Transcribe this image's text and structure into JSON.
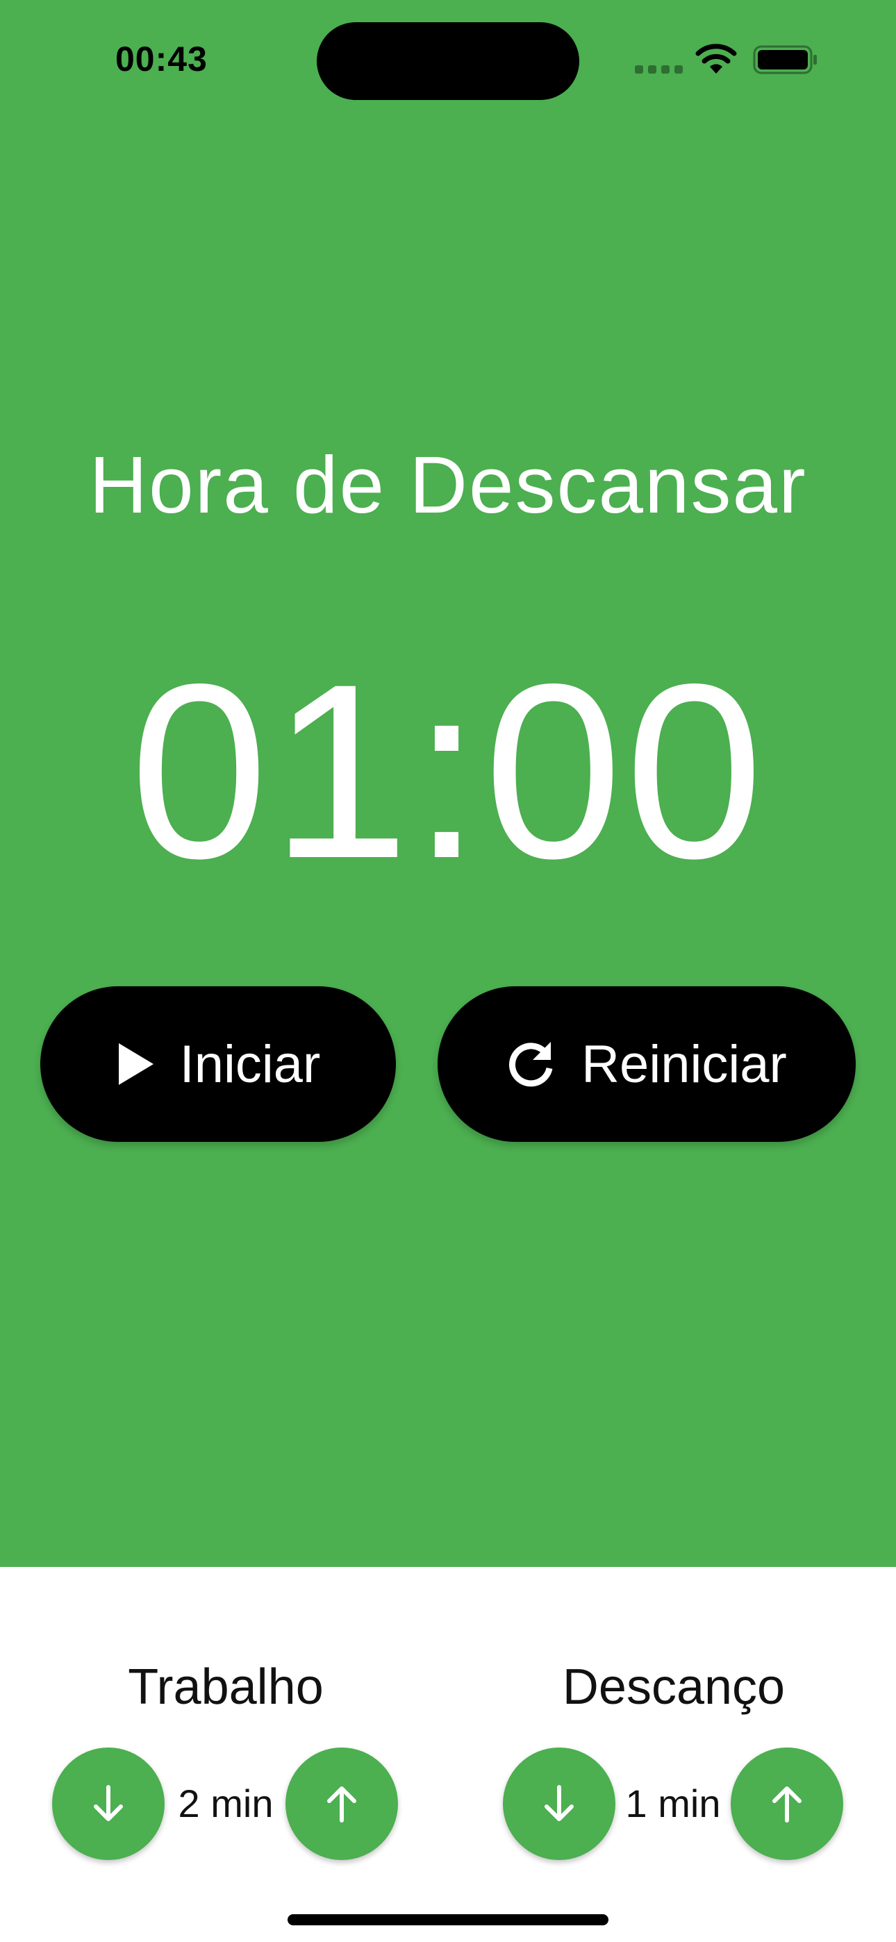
{
  "status_bar": {
    "time": "00:43"
  },
  "screen": {
    "background_color": "#4caf50",
    "title": "Hora de Descansar",
    "timer": "01:00"
  },
  "actions": {
    "start": {
      "label": "Iniciar",
      "icon": "play-icon"
    },
    "reset": {
      "label": "Reiniciar",
      "icon": "refresh-icon"
    }
  },
  "settings": {
    "work": {
      "label": "Trabalho",
      "value": "2 min",
      "decrease_icon": "arrow-down-icon",
      "increase_icon": "arrow-up-icon"
    },
    "rest": {
      "label": "Descanço",
      "value": "1 min",
      "decrease_icon": "arrow-down-icon",
      "increase_icon": "arrow-up-icon"
    }
  }
}
